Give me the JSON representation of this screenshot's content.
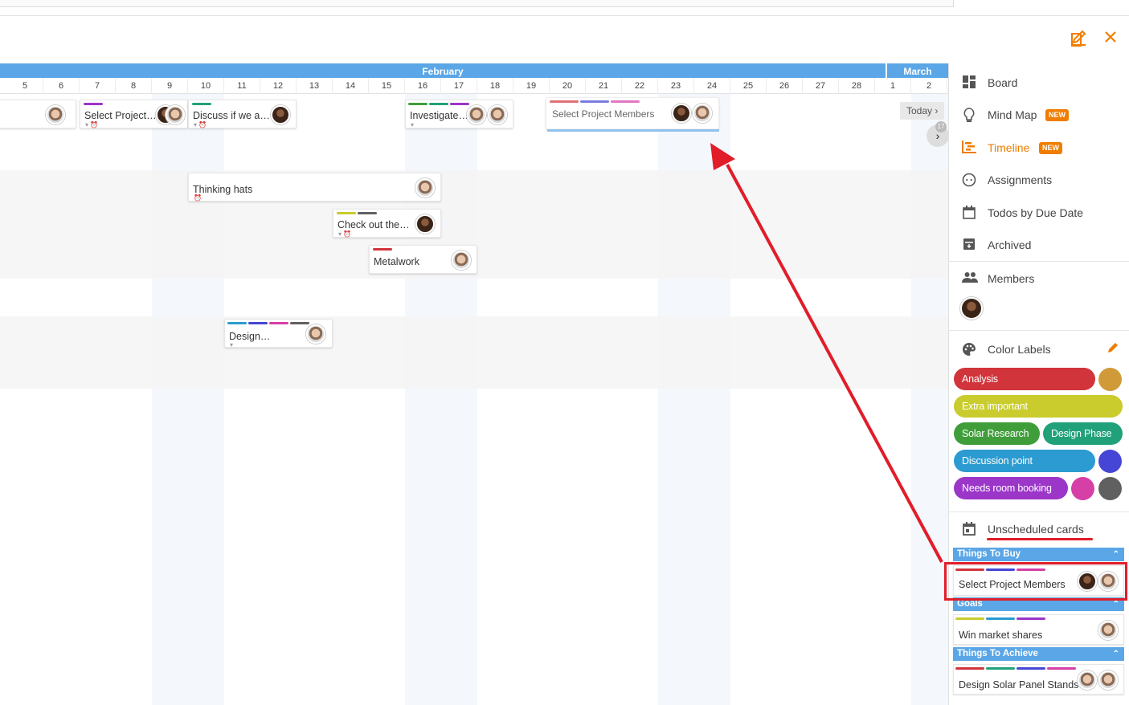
{
  "header": {
    "edit_icon": "edit-icon",
    "close_icon": "close-icon"
  },
  "timeline": {
    "months": [
      {
        "label": "February"
      },
      {
        "label": "March"
      }
    ],
    "days": [
      "5",
      "6",
      "7",
      "8",
      "9",
      "10",
      "11",
      "12",
      "13",
      "14",
      "15",
      "16",
      "17",
      "18",
      "19",
      "20",
      "21",
      "22",
      "23",
      "24",
      "25",
      "26",
      "27",
      "28",
      "1",
      "2"
    ],
    "today_label": "Today",
    "counter": "17",
    "cards": {
      "c1": {
        "title": ""
      },
      "c2": {
        "title": "Select Project…"
      },
      "c3": {
        "title": "Discuss if we a…"
      },
      "c4": {
        "title": "Investigate…"
      },
      "c5": {
        "title": "Select Project Members"
      },
      "c6": {
        "title": "Thinking hats"
      },
      "c7": {
        "title": "Check out the…"
      },
      "c8": {
        "title": "Metalwork"
      },
      "c9": {
        "title": "Design…"
      }
    }
  },
  "sidebar": {
    "nav": [
      {
        "label": "Board",
        "icon": "board-icon"
      },
      {
        "label": "Mind Map",
        "icon": "lightbulb-icon",
        "badge": "NEW"
      },
      {
        "label": "Timeline",
        "icon": "timeline-icon",
        "badge": "NEW"
      },
      {
        "label": "Assignments",
        "icon": "face-icon"
      },
      {
        "label": "Todos by Due Date",
        "icon": "calendar-icon"
      },
      {
        "label": "Archived",
        "icon": "archive-icon"
      }
    ],
    "members": {
      "label": "Members",
      "icon": "members-icon"
    },
    "color_labels": {
      "label": "Color Labels",
      "items": [
        {
          "name": "Analysis",
          "color": "#d1343b"
        },
        {
          "name": "Extra important",
          "color": "#c9cc2c"
        },
        {
          "name": "Solar Research",
          "color": "#3f9e3a"
        },
        {
          "name": "Design Phase",
          "color": "#21a179"
        },
        {
          "name": "Discussion point",
          "color": "#2b9bd1"
        },
        {
          "name": "Needs room booking",
          "color": "#9b36c9"
        }
      ],
      "dots": [
        "#d19a38",
        "#4545d6",
        "#d63fa6",
        "#606060"
      ]
    },
    "unscheduled": {
      "label": "Unscheduled cards",
      "groups": [
        {
          "name": "Things To Buy",
          "card": "Select Project Members"
        },
        {
          "name": "Goals",
          "card": "Win market shares"
        },
        {
          "name": "Things To Achieve",
          "card": "Design Solar Panel Stands"
        }
      ]
    }
  },
  "colors": {
    "accent": "#f07d00",
    "month": "#5aa6e6",
    "annotation": "#e11d2a"
  }
}
